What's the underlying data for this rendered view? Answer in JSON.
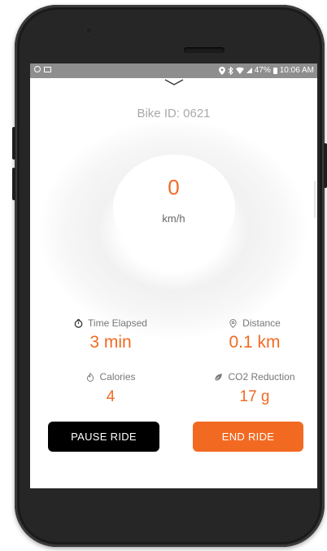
{
  "status_bar": {
    "battery": "47%",
    "time": "10:06 AM"
  },
  "header": {
    "bike_id": "Bike ID: 0621"
  },
  "speedometer": {
    "value": "0",
    "unit": "km/h"
  },
  "stats": {
    "time_elapsed": {
      "label": "Time Elapsed",
      "value": "3 min",
      "icon": "stopwatch-icon"
    },
    "distance": {
      "label": "Distance",
      "value": "0.1 km",
      "icon": "location-pin-icon"
    },
    "calories": {
      "label": "Calories",
      "value": "4",
      "icon": "flame-icon"
    },
    "co2_reduction": {
      "label": "CO2 Reduction",
      "value": "17 g",
      "icon": "leaf-icon"
    }
  },
  "actions": {
    "pause_label": "PAUSE RIDE",
    "end_label": "END RIDE"
  },
  "colors": {
    "accent": "#f26a22",
    "pause_button": "#000000",
    "status_bar": "#8e8e8e",
    "phone_frame": "#262626"
  }
}
